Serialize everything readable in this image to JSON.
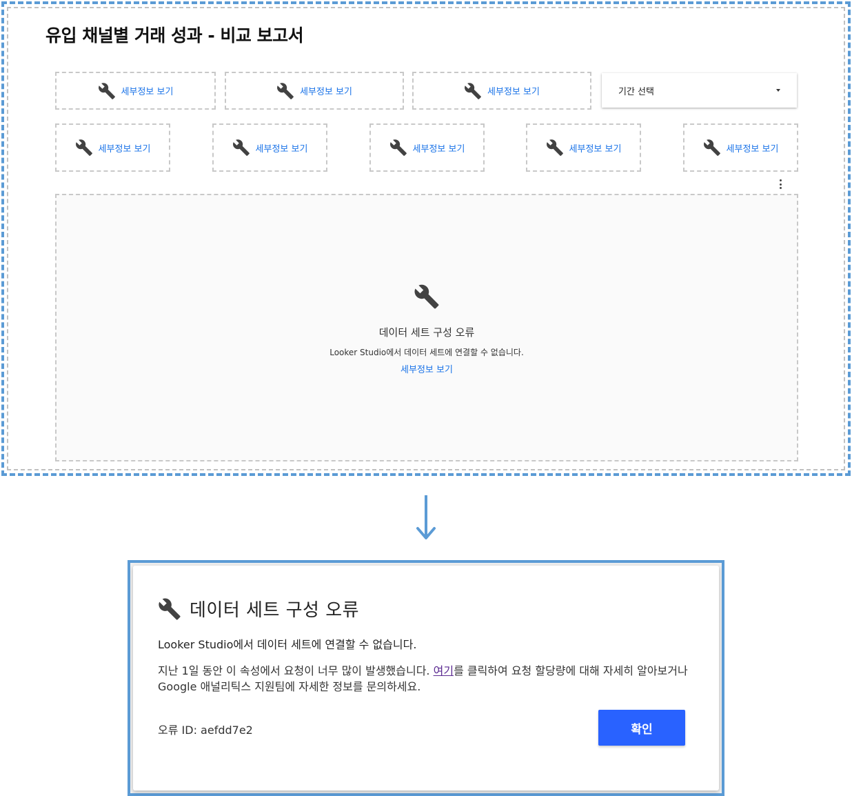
{
  "report": {
    "title": "유입 채널별 거래 성과 - 비교 보고서",
    "tile_link_label": "세부정보 보기",
    "row1_tiles": [
      {
        "label": "세부정보 보기"
      },
      {
        "label": "세부정보 보기"
      },
      {
        "label": "세부정보 보기"
      }
    ],
    "date_picker": {
      "label": "기간 선택"
    },
    "row2_tiles": [
      {
        "label": "세부정보 보기"
      },
      {
        "label": "세부정보 보기"
      },
      {
        "label": "세부정보 보기"
      },
      {
        "label": "세부정보 보기"
      },
      {
        "label": "세부정보 보기"
      }
    ],
    "panel": {
      "title": "데이터 세트 구성 오류",
      "message": "Looker Studio에서 데이터 세트에 연결할 수 없습니다.",
      "link": "세부정보 보기"
    }
  },
  "dialog": {
    "title": "데이터 세트 구성 오류",
    "message": "Looker Studio에서 데이터 세트에 연결할 수 없습니다.",
    "detail_before": "지난 1일 동안 이 속성에서 요청이 너무 많이 발생했습니다. ",
    "detail_link": "여기",
    "detail_after": "를 클릭하여 요청 할당량에 대해 자세히 알아보거나 Google 애널리틱스 지원팀에 자세한 정보를 문의하세요.",
    "error_id": "오류 ID: aefdd7e2",
    "confirm_button": "확인"
  },
  "colors": {
    "frame_border": "#5b9bd5",
    "link": "#1a73e8",
    "button": "#2962ff"
  },
  "icons": {
    "tile": "wrench-icon",
    "dropdown": "caret-down-icon",
    "menu": "more-vert-icon",
    "flow": "arrow-down-icon"
  }
}
